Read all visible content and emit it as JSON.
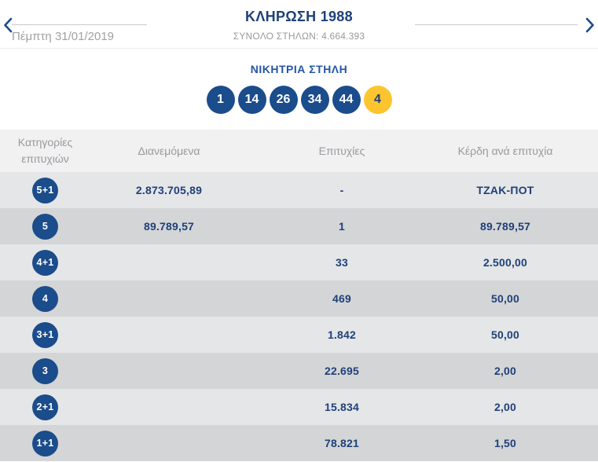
{
  "header": {
    "title": "ΚΛΗΡΩΣΗ 1988",
    "total_columns": "ΣΥΝΟΛΟ ΣΤΗΛΩΝ: 4.664.393",
    "date": "Πέμπτη 31/01/2019"
  },
  "winning": {
    "label": "ΝΙΚΗΤΡΙΑ ΣΤΗΛΗ",
    "numbers": [
      "1",
      "14",
      "26",
      "34",
      "44"
    ],
    "bonus": "4"
  },
  "table": {
    "columns": [
      "Κατηγορίες επιτυχιών",
      "Διανεμόμενα",
      "Επιτυχίες",
      "Κέρδη ανά επιτυχία"
    ],
    "rows": [
      {
        "category": "5+1",
        "distributed": "2.873.705,89",
        "winners": "-",
        "prize": "ΤΖΑΚ-ΠΟΤ"
      },
      {
        "category": "5",
        "distributed": "89.789,57",
        "winners": "1",
        "prize": "89.789,57"
      },
      {
        "category": "4+1",
        "distributed": "",
        "winners": "33",
        "prize": "2.500,00"
      },
      {
        "category": "4",
        "distributed": "",
        "winners": "469",
        "prize": "50,00"
      },
      {
        "category": "3+1",
        "distributed": "",
        "winners": "1.842",
        "prize": "50,00"
      },
      {
        "category": "3",
        "distributed": "",
        "winners": "22.695",
        "prize": "2,00"
      },
      {
        "category": "2+1",
        "distributed": "",
        "winners": "15.834",
        "prize": "2,00"
      },
      {
        "category": "1+1",
        "distributed": "",
        "winners": "78.821",
        "prize": "1,50"
      }
    ]
  },
  "colors": {
    "primary-blue": "#1b4c8b",
    "navy-text": "#1e4078",
    "label-blue": "#2356a5",
    "bonus-yellow": "#fcc42e",
    "muted-text": "#98999c",
    "line-grey": "#c8cacc",
    "row-light": "#e5e6e8",
    "row-dark": "#d4d5d7",
    "header-band": "#f1f1f2"
  }
}
